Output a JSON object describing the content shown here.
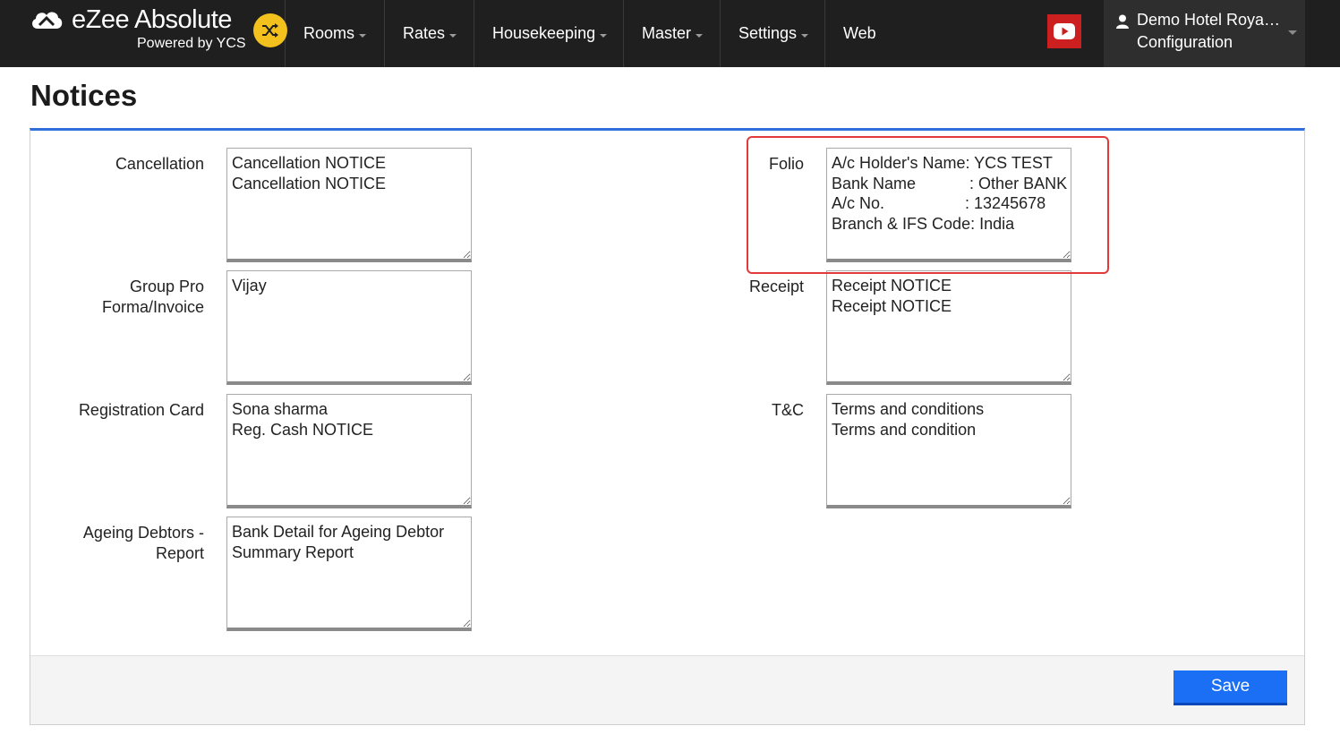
{
  "brand": {
    "name": "eZee Absolute",
    "subtitle": "Powered by YCS"
  },
  "nav": {
    "items": [
      {
        "label": "Rooms",
        "has_dropdown": true
      },
      {
        "label": "Rates",
        "has_dropdown": true
      },
      {
        "label": "Housekeeping",
        "has_dropdown": true
      },
      {
        "label": "Master",
        "has_dropdown": true
      },
      {
        "label": "Settings",
        "has_dropdown": true
      },
      {
        "label": "Web",
        "has_dropdown": false
      }
    ]
  },
  "user": {
    "hotel_name": "Demo Hotel Roya…",
    "role": "Configuration"
  },
  "page": {
    "title": "Notices"
  },
  "notices": {
    "cancellation": {
      "label": "Cancellation",
      "value": "Cancellation NOTICE\nCancellation NOTICE"
    },
    "group_pro_forma": {
      "label": "Group Pro\nForma/Invoice",
      "value": "Vijay"
    },
    "registration_card": {
      "label": "Registration Card",
      "value": "Sona sharma\nReg. Cash NOTICE"
    },
    "ageing_debtors": {
      "label": "Ageing Debtors -\nReport",
      "value": "Bank Detail for Ageing Debtor\nSummary Report"
    },
    "folio": {
      "label": "Folio",
      "value": "A/c Holder's Name: YCS TEST\nBank Name            : Other BANK\nA/c No.                  : 13245678\nBranch & IFS Code: India"
    },
    "receipt": {
      "label": "Receipt",
      "value": "Receipt NOTICE\nReceipt NOTICE"
    },
    "tnc": {
      "label": "T&C",
      "value": "Terms and conditions\nTerms and condition"
    }
  },
  "footer": {
    "save_label": "Save"
  },
  "colors": {
    "topbar": "#1f1f1f",
    "accent_blue": "#1a6ff5",
    "panel_top_border": "#2f6fdc",
    "highlight_red": "#e23a3a",
    "brand_badge": "#f3c11d",
    "youtube_red": "#cc1f1f"
  },
  "icons": {
    "logo": "ezee-cloud-logo-icon",
    "brand_badge": "shuffle-icon",
    "video": "youtube-icon",
    "user": "user-icon"
  }
}
